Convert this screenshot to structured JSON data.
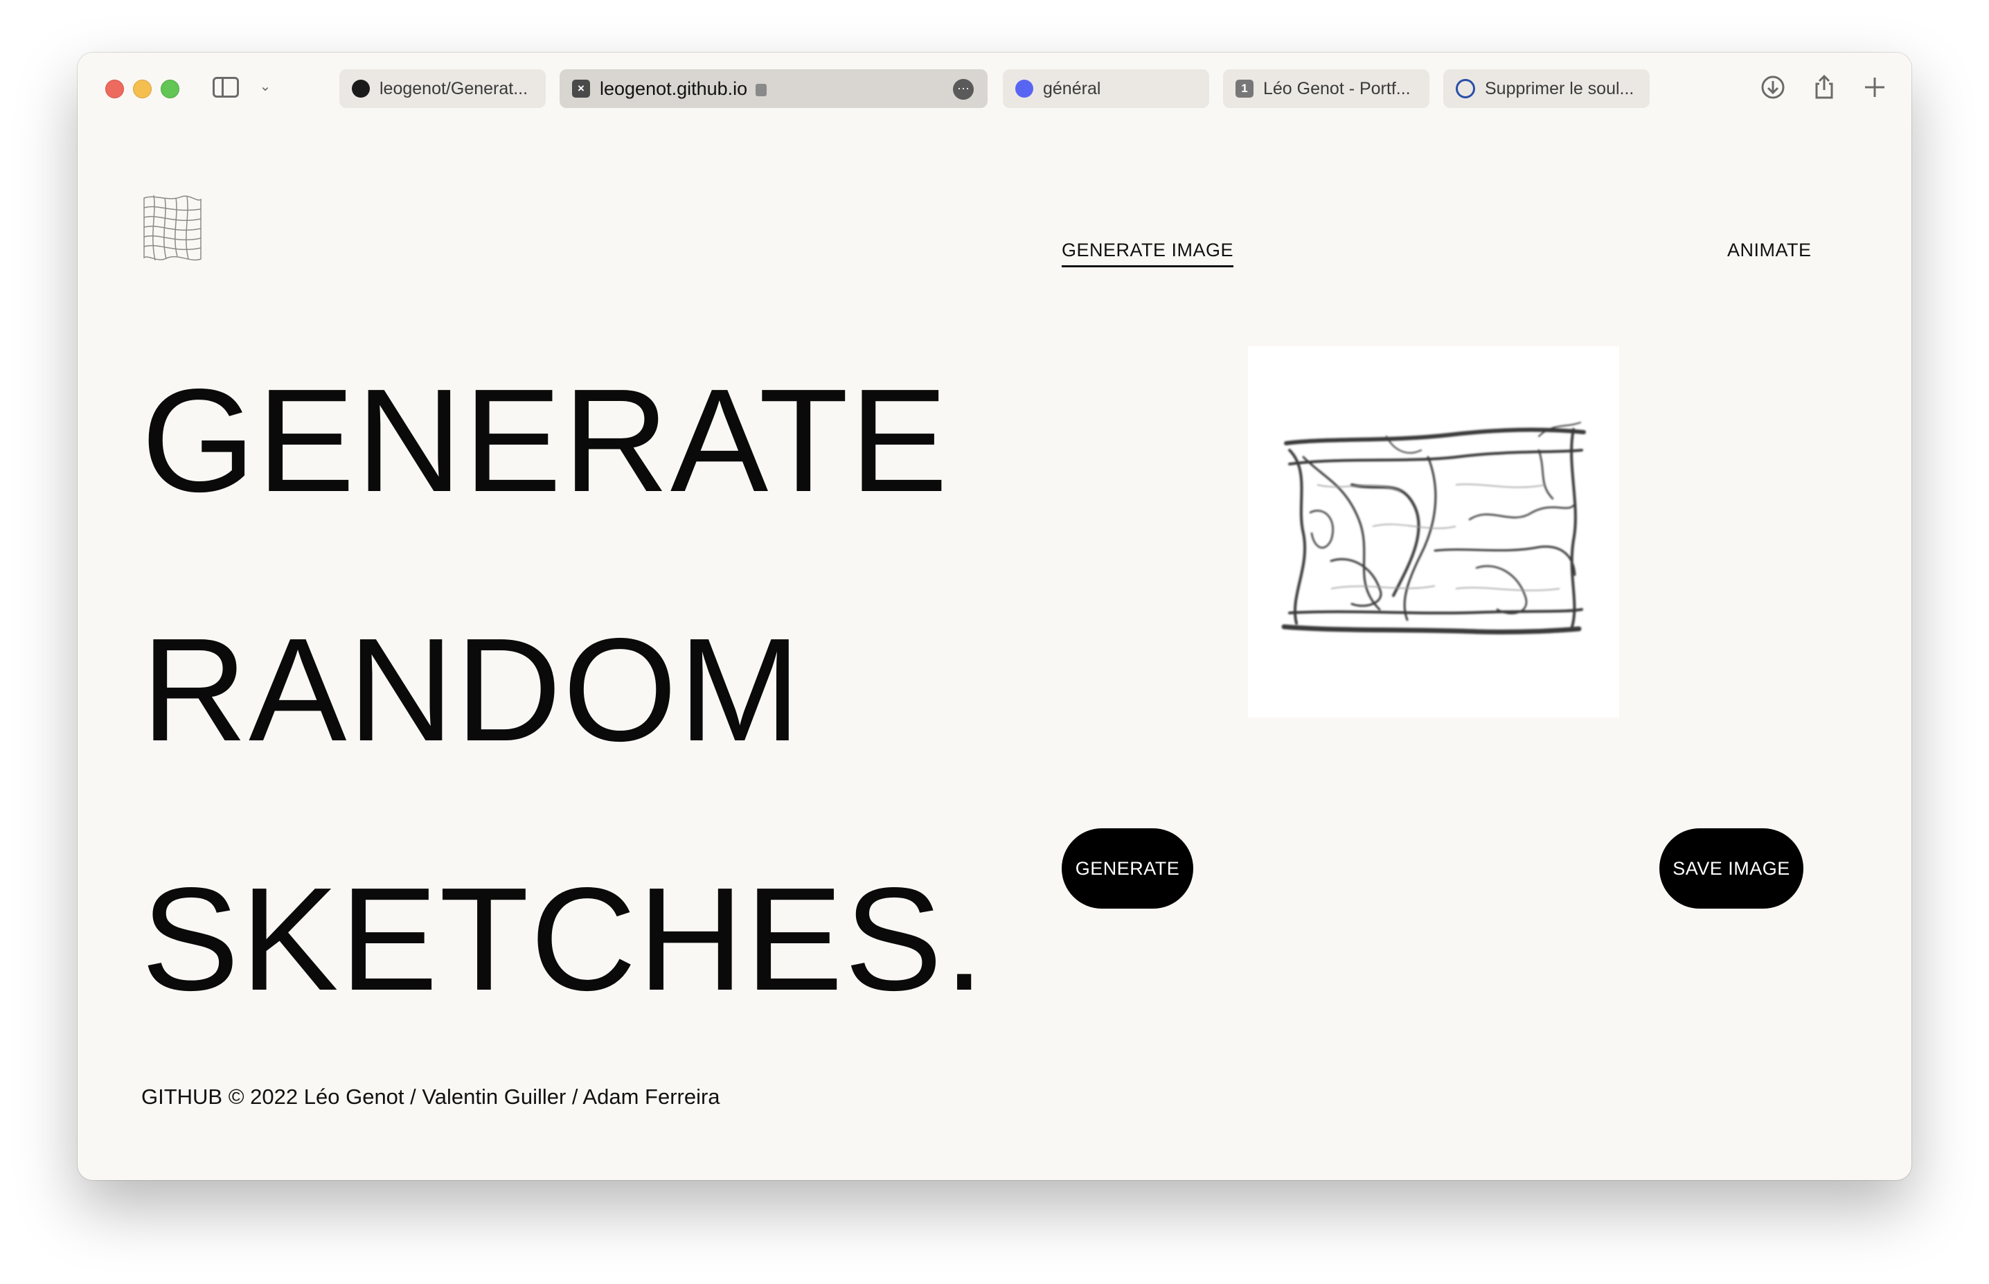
{
  "browser": {
    "tabs": [
      {
        "label": "leogenot/Generat...",
        "icon": "github-icon"
      },
      {
        "label": "leogenot.github.io",
        "icon": "site-icon",
        "active": true
      },
      {
        "label": "général",
        "icon": "discord-icon"
      },
      {
        "label": "Léo Genot - Portf...",
        "icon": "number-icon",
        "icon_text": "1"
      },
      {
        "label": "Supprimer le soul...",
        "icon": "gear-icon"
      }
    ]
  },
  "nav": {
    "generate_image": "GENERATE IMAGE",
    "animate": "ANIMATE"
  },
  "hero": {
    "line1": "GENERATE",
    "line2": "RANDOM",
    "line3": "SKETCHES."
  },
  "actions": {
    "generate": "GENERATE",
    "save": "SAVE IMAGE"
  },
  "footer": {
    "text": "GITHUB © 2022 Léo Genot / Valentin Guiller / Adam Ferreira"
  },
  "colors": {
    "page_bg": "#faf8f4",
    "button_bg": "#000000",
    "text": "#0a0a0a"
  }
}
